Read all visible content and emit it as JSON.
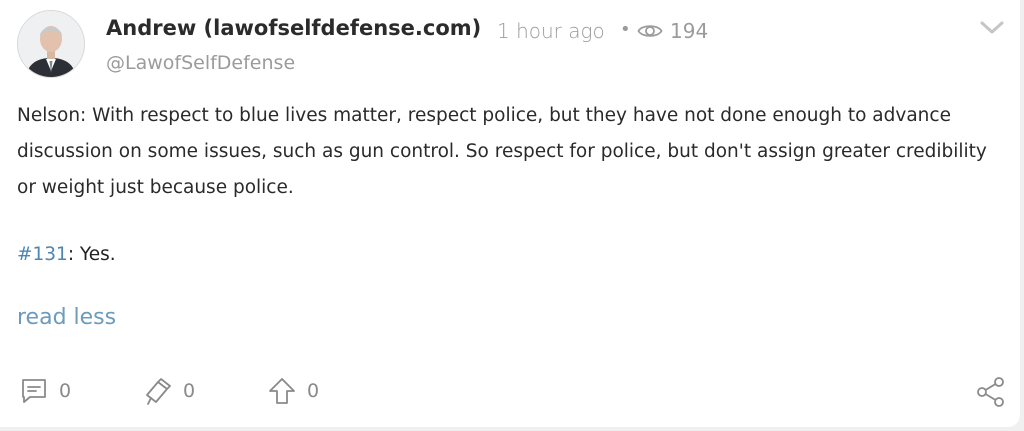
{
  "post": {
    "author": "Andrew (lawofselfdefense.com)",
    "time": "1 hour ago",
    "separator": "•",
    "views": "194",
    "handle": "@LawofSelfDefense",
    "paragraph": "Nelson: With respect to blue lives matter, respect police, but they have not done enough to advance discussion on some issues, such as gun control. So respect for police, but don't assign greater credibility or weight just because police.",
    "hashtag": "#131",
    "reply_rest": ": Yes.",
    "read_less": "read less"
  },
  "actions": {
    "comments": "0",
    "reposts": "0",
    "upvotes": "0"
  },
  "colors": {
    "link": "#4d86b3",
    "muted": "#9b9b9b",
    "icon": "#8a8a8a"
  },
  "icons": [
    "eye-icon",
    "chevron-down-icon",
    "comment-icon",
    "repost-icon",
    "upvote-icon",
    "share-icon"
  ]
}
